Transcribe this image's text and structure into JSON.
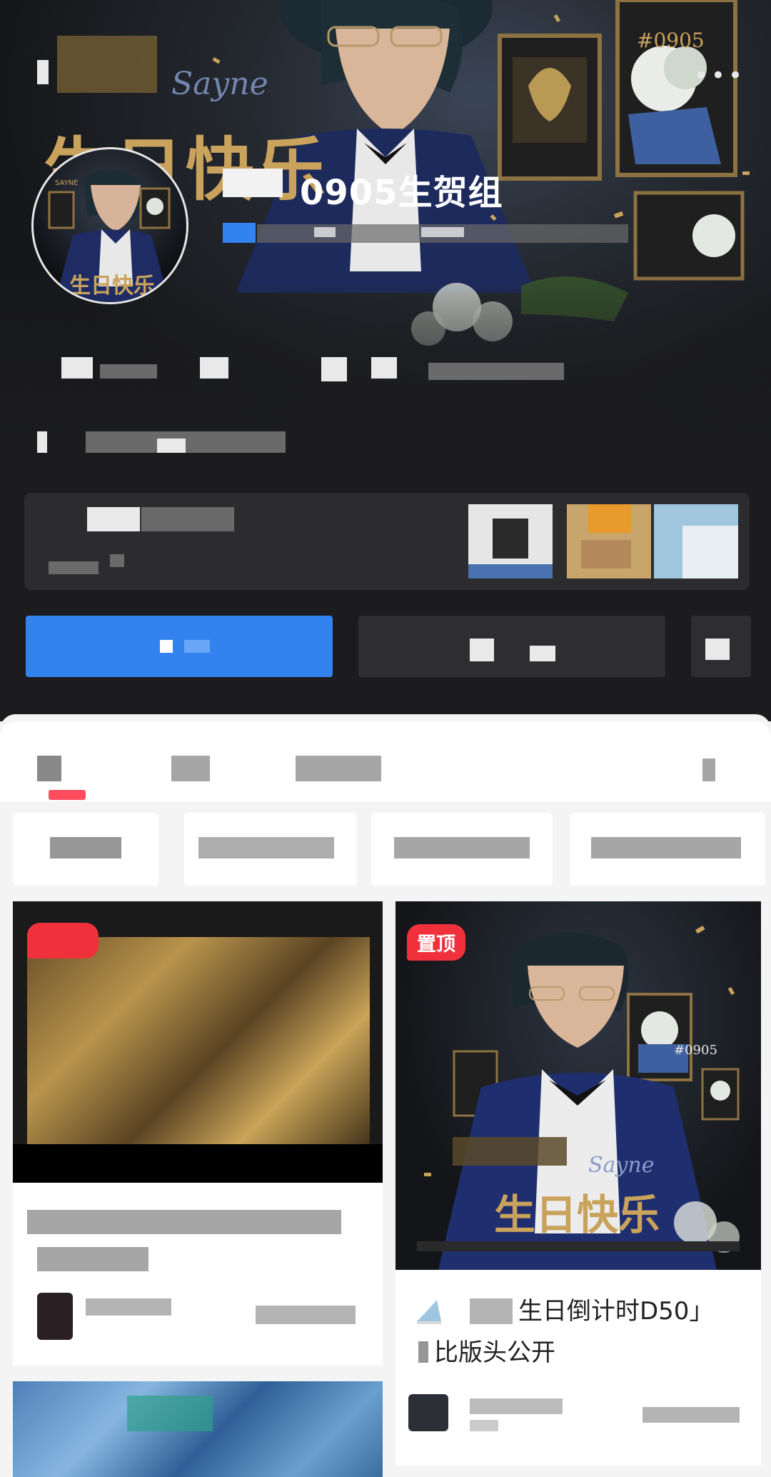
{
  "profile": {
    "group_name": "0905生贺组",
    "more_icon": "more-dots-icon"
  },
  "banner": {
    "tag": "#0905",
    "headline": "生日快乐",
    "script_text": "Sayne"
  },
  "avatar": {
    "tag": "SAYNE",
    "headline": "生日快乐"
  },
  "feed": {
    "right_card": {
      "pin_badge": "置顶",
      "cover_tag": "#0905",
      "cover_script": "Sayne",
      "cover_headline": "生日快乐",
      "title_line1": "生日倒计时D50」",
      "title_line2": "比版头公开"
    }
  },
  "colors": {
    "follow_button": "#3283f0",
    "pin_badge": "#f0313c",
    "tab_indicator": "#ff4d5e",
    "header_bg": "#1c1c1e"
  }
}
